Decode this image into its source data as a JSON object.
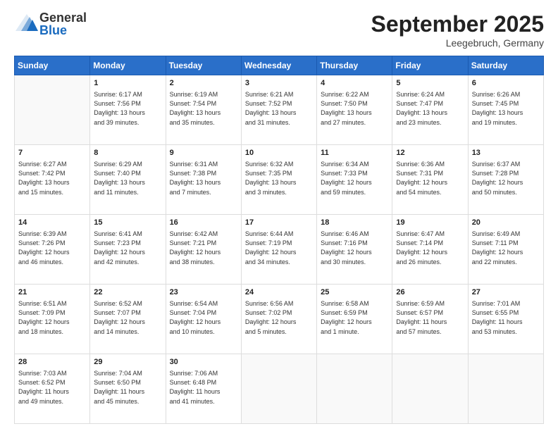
{
  "header": {
    "logo_general": "General",
    "logo_blue": "Blue",
    "month_title": "September 2025",
    "location": "Leegebruch, Germany"
  },
  "days_of_week": [
    "Sunday",
    "Monday",
    "Tuesday",
    "Wednesday",
    "Thursday",
    "Friday",
    "Saturday"
  ],
  "weeks": [
    [
      {
        "day": null,
        "info": null
      },
      {
        "day": "1",
        "info": "Sunrise: 6:17 AM\nSunset: 7:56 PM\nDaylight: 13 hours\nand 39 minutes."
      },
      {
        "day": "2",
        "info": "Sunrise: 6:19 AM\nSunset: 7:54 PM\nDaylight: 13 hours\nand 35 minutes."
      },
      {
        "day": "3",
        "info": "Sunrise: 6:21 AM\nSunset: 7:52 PM\nDaylight: 13 hours\nand 31 minutes."
      },
      {
        "day": "4",
        "info": "Sunrise: 6:22 AM\nSunset: 7:50 PM\nDaylight: 13 hours\nand 27 minutes."
      },
      {
        "day": "5",
        "info": "Sunrise: 6:24 AM\nSunset: 7:47 PM\nDaylight: 13 hours\nand 23 minutes."
      },
      {
        "day": "6",
        "info": "Sunrise: 6:26 AM\nSunset: 7:45 PM\nDaylight: 13 hours\nand 19 minutes."
      }
    ],
    [
      {
        "day": "7",
        "info": "Sunrise: 6:27 AM\nSunset: 7:42 PM\nDaylight: 13 hours\nand 15 minutes."
      },
      {
        "day": "8",
        "info": "Sunrise: 6:29 AM\nSunset: 7:40 PM\nDaylight: 13 hours\nand 11 minutes."
      },
      {
        "day": "9",
        "info": "Sunrise: 6:31 AM\nSunset: 7:38 PM\nDaylight: 13 hours\nand 7 minutes."
      },
      {
        "day": "10",
        "info": "Sunrise: 6:32 AM\nSunset: 7:35 PM\nDaylight: 13 hours\nand 3 minutes."
      },
      {
        "day": "11",
        "info": "Sunrise: 6:34 AM\nSunset: 7:33 PM\nDaylight: 12 hours\nand 59 minutes."
      },
      {
        "day": "12",
        "info": "Sunrise: 6:36 AM\nSunset: 7:31 PM\nDaylight: 12 hours\nand 54 minutes."
      },
      {
        "day": "13",
        "info": "Sunrise: 6:37 AM\nSunset: 7:28 PM\nDaylight: 12 hours\nand 50 minutes."
      }
    ],
    [
      {
        "day": "14",
        "info": "Sunrise: 6:39 AM\nSunset: 7:26 PM\nDaylight: 12 hours\nand 46 minutes."
      },
      {
        "day": "15",
        "info": "Sunrise: 6:41 AM\nSunset: 7:23 PM\nDaylight: 12 hours\nand 42 minutes."
      },
      {
        "day": "16",
        "info": "Sunrise: 6:42 AM\nSunset: 7:21 PM\nDaylight: 12 hours\nand 38 minutes."
      },
      {
        "day": "17",
        "info": "Sunrise: 6:44 AM\nSunset: 7:19 PM\nDaylight: 12 hours\nand 34 minutes."
      },
      {
        "day": "18",
        "info": "Sunrise: 6:46 AM\nSunset: 7:16 PM\nDaylight: 12 hours\nand 30 minutes."
      },
      {
        "day": "19",
        "info": "Sunrise: 6:47 AM\nSunset: 7:14 PM\nDaylight: 12 hours\nand 26 minutes."
      },
      {
        "day": "20",
        "info": "Sunrise: 6:49 AM\nSunset: 7:11 PM\nDaylight: 12 hours\nand 22 minutes."
      }
    ],
    [
      {
        "day": "21",
        "info": "Sunrise: 6:51 AM\nSunset: 7:09 PM\nDaylight: 12 hours\nand 18 minutes."
      },
      {
        "day": "22",
        "info": "Sunrise: 6:52 AM\nSunset: 7:07 PM\nDaylight: 12 hours\nand 14 minutes."
      },
      {
        "day": "23",
        "info": "Sunrise: 6:54 AM\nSunset: 7:04 PM\nDaylight: 12 hours\nand 10 minutes."
      },
      {
        "day": "24",
        "info": "Sunrise: 6:56 AM\nSunset: 7:02 PM\nDaylight: 12 hours\nand 5 minutes."
      },
      {
        "day": "25",
        "info": "Sunrise: 6:58 AM\nSunset: 6:59 PM\nDaylight: 12 hours\nand 1 minute."
      },
      {
        "day": "26",
        "info": "Sunrise: 6:59 AM\nSunset: 6:57 PM\nDaylight: 11 hours\nand 57 minutes."
      },
      {
        "day": "27",
        "info": "Sunrise: 7:01 AM\nSunset: 6:55 PM\nDaylight: 11 hours\nand 53 minutes."
      }
    ],
    [
      {
        "day": "28",
        "info": "Sunrise: 7:03 AM\nSunset: 6:52 PM\nDaylight: 11 hours\nand 49 minutes."
      },
      {
        "day": "29",
        "info": "Sunrise: 7:04 AM\nSunset: 6:50 PM\nDaylight: 11 hours\nand 45 minutes."
      },
      {
        "day": "30",
        "info": "Sunrise: 7:06 AM\nSunset: 6:48 PM\nDaylight: 11 hours\nand 41 minutes."
      },
      {
        "day": null,
        "info": null
      },
      {
        "day": null,
        "info": null
      },
      {
        "day": null,
        "info": null
      },
      {
        "day": null,
        "info": null
      }
    ]
  ]
}
